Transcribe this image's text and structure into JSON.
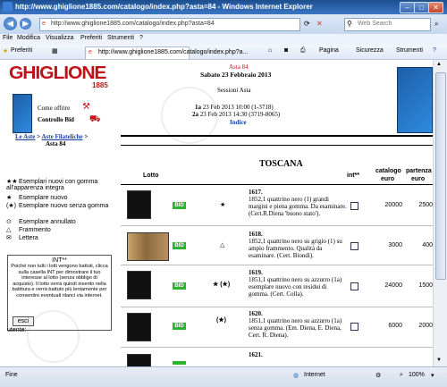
{
  "window": {
    "title": "http://www.ghiglione1885.com/catalogo/index.php?asta=84 - Windows Internet Explorer"
  },
  "address": {
    "url": "http://www.ghiglione1885.com/catalogo/index.php?asta=84"
  },
  "search": {
    "placeholder": "Web Search"
  },
  "menu": [
    "File",
    "Modifica",
    "Visualizza",
    "Preferiti",
    "Strumenti",
    "?"
  ],
  "favorites": {
    "label": "Preferiti",
    "tab_title": "http://www.ghiglione1885.com/catalogo/index.php?a...",
    "pagina": "Pagina",
    "sicurezza": "Sicurezza",
    "strumenti": "Strumenti"
  },
  "site": {
    "logo": "GHIGLIONE",
    "year": "1885",
    "come_offrire": "Come offrire",
    "controllo_bid": "Controllo Bid"
  },
  "breadcrumb": {
    "aste": "Le Aste",
    "filateliche": "Aste Filateliche",
    "sep": ">",
    "asta": "Asta 84"
  },
  "header": {
    "asta": "Asta 84",
    "date": "Sabato 23 Febbraio 2013",
    "sessions_label": "Sessioni Asta",
    "s1_prefix": "1a",
    "s1": "23 Feb 2013 10:00 (1-3718)",
    "s2_prefix": "2a",
    "s2": "23 Feb 2013 14:30 (3719-8065)",
    "index": "Indice"
  },
  "section": {
    "title": "TOSCANA"
  },
  "columns": {
    "lotto": "Lotto",
    "int": "int**",
    "catalogo": "catalogo",
    "catalogo_unit": "euro",
    "partenza": "partenza",
    "partenza_unit": "euro"
  },
  "legend": [
    {
      "sym": "★★",
      "text": "Esemplari nuovi con gomma all'apparenza integra"
    },
    {
      "sym": "★",
      "text": "Esemplare nuovo"
    },
    {
      "sym": "(★)",
      "text": "Esemplare nuovo senza gomma"
    },
    {
      "sym": "⊙",
      "text": "Esemplare annullato"
    },
    {
      "sym": "△",
      "text": "Frammento"
    },
    {
      "sym": "✉",
      "text": "Lettera"
    }
  ],
  "int_note": {
    "title": "INT**",
    "text": "Poiché non tutti i lotti vengono battuti, clicca sulla casella INT per dimostrare il tuo interesse al lotto (senza obbligo di acquisto). Il lotto verrà quindi inserito nella battitura e verrà battuto più lentamente per consentire eventuali rilanci via internet.",
    "exit": "esci",
    "user_label": "utente:"
  },
  "lots": [
    {
      "bid": "BID",
      "cond": "★",
      "num": "1617.",
      "desc": "1852,1 quattrino nero (1) grandi margini e piena gomma. Da esaminare.(Cert.R.Diena 'buono stato').",
      "catalogo": "20000",
      "partenza": "2500"
    },
    {
      "bid": "BID",
      "cond": "△",
      "num": "1618.",
      "desc": "1852,1 quattrino nero su grigio (1) su ampio frammento. Qualità da esaminare. (Cert. Biondi).",
      "catalogo": "3000",
      "partenza": "400"
    },
    {
      "bid": "BID",
      "cond": "★ (★)",
      "num": "1619.",
      "desc": "1851,1 quattrino nero su azzurro (1a) esemplare nuovo con residui di gomma. (Cert. Colla).",
      "catalogo": "24000",
      "partenza": "1500"
    },
    {
      "bid": "BID",
      "cond": "(★)",
      "num": "1620.",
      "desc": "1851,1 quattrino nero su azzurro (1a) senza gomma. (Em. Diena, E. Diena, Cert. R. Diena).",
      "catalogo": "6000",
      "partenza": "2000"
    },
    {
      "bid": "",
      "cond": "",
      "num": "1621.",
      "desc": "",
      "catalogo": "",
      "partenza": ""
    }
  ],
  "status": {
    "left": "Fine",
    "zone": "Internet",
    "zoom": "100%"
  }
}
